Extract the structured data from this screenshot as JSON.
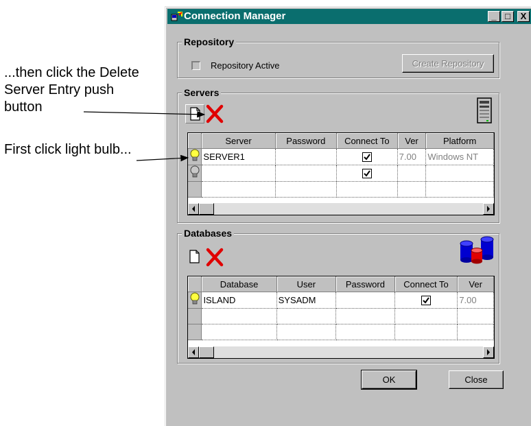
{
  "annotations": {
    "delete_hint": "...then click the Delete Server Entry push button",
    "bulb_hint": "First click light bulb..."
  },
  "window": {
    "title": "Connection Manager",
    "minimize_label": "_",
    "maximize_label": "□",
    "close_label": "X",
    "title_bar_color": "#0a6e6e"
  },
  "repository": {
    "group_label": "Repository",
    "active_label": "Repository Active",
    "active_checked": false,
    "create_label": "Create Repository"
  },
  "servers": {
    "group_label": "Servers",
    "toolbar": {
      "new_icon": "new-document-icon",
      "delete_icon": "red-x-delete-icon"
    },
    "columns": [
      "Server",
      "Password",
      "Connect To",
      "Ver",
      "Platform"
    ],
    "rows": [
      {
        "server": "SERVER1",
        "password": "",
        "connect": true,
        "ver": "7.00",
        "platform": "Windows NT",
        "bulb": "lit"
      },
      {
        "server": "",
        "password": "",
        "connect": true,
        "ver": "",
        "platform": "",
        "bulb": "unlit"
      },
      {
        "server": "",
        "password": "",
        "connect": false,
        "ver": "",
        "platform": "",
        "bulb": "none"
      }
    ]
  },
  "databases": {
    "group_label": "Databases",
    "toolbar": {
      "new_icon": "new-document-icon",
      "delete_icon": "red-x-delete-icon"
    },
    "columns": [
      "Database",
      "User",
      "Password",
      "Connect To",
      "Ver"
    ],
    "rows": [
      {
        "database": "ISLAND",
        "user": "SYSADM",
        "password": "",
        "connect": true,
        "ver": "7.00",
        "bulb": "lit"
      },
      {
        "database": "",
        "user": "",
        "password": "",
        "connect": false,
        "ver": "",
        "bulb": "none"
      },
      {
        "database": "",
        "user": "",
        "password": "",
        "connect": false,
        "ver": "",
        "bulb": "none"
      }
    ]
  },
  "footer": {
    "ok_label": "OK",
    "close_label": "Close"
  }
}
